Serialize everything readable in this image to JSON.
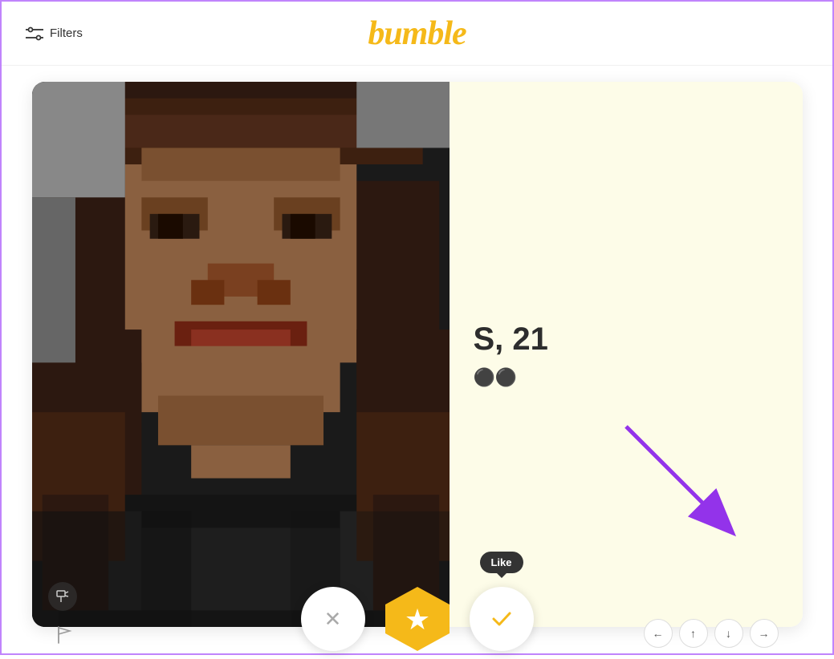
{
  "header": {
    "logo": "bumble",
    "filters_label": "Filters"
  },
  "card": {
    "name_age": "S, 21",
    "photo_alt": "Profile photo (pixelated)",
    "info_bg": "#fdfce8"
  },
  "actions": {
    "dislike_label": "✕",
    "superlike_label": "★",
    "like_label": "✓",
    "like_tooltip": "Like"
  },
  "nav": {
    "left_arrow": "←",
    "up_arrow": "↑",
    "down_arrow": "↓",
    "right_arrow": "→"
  },
  "colors": {
    "brand_yellow": "#f5b919",
    "card_bg": "#fdfce8",
    "purple_accent": "#9333ea",
    "dark_text": "#2d2d2d"
  }
}
